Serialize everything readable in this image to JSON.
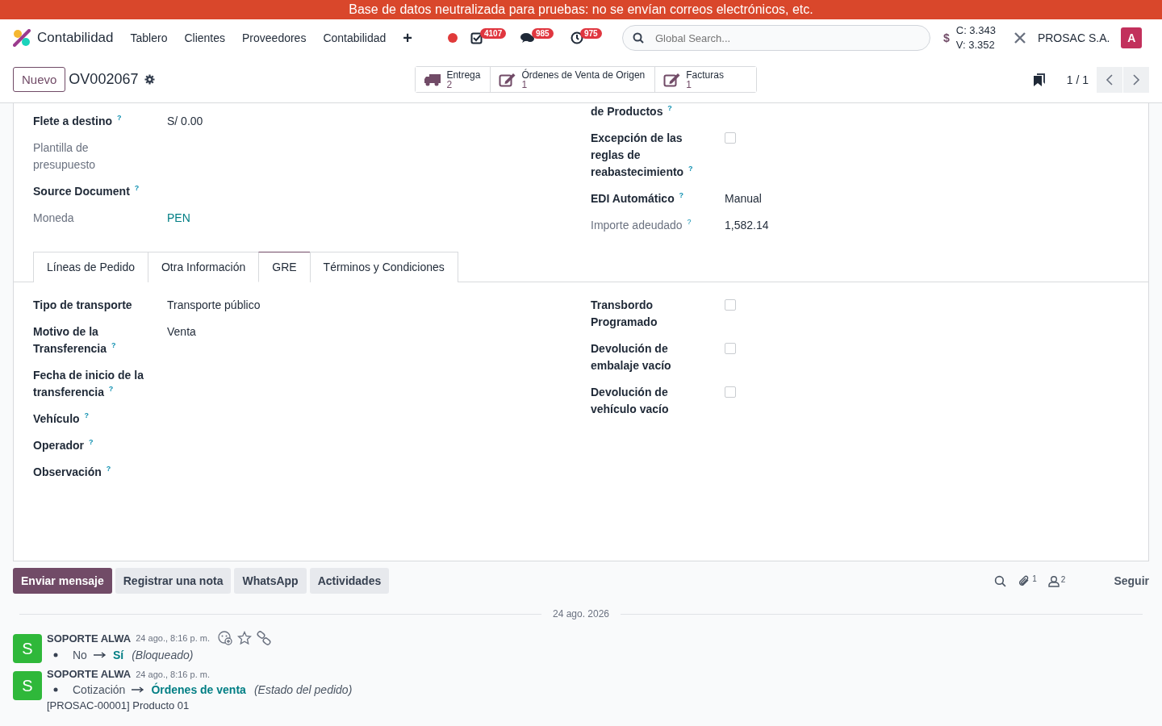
{
  "banner": "Base de datos neutralizada para pruebas: no se envían correos electrónicos, etc.",
  "navbar": {
    "app": "Contabilidad",
    "menu": [
      "Tablero",
      "Clientes",
      "Proveedores",
      "Contabilidad"
    ],
    "plus": "+",
    "systray": [
      {
        "kind": "todo",
        "badge": "4107"
      },
      {
        "kind": "chat",
        "badge": "985"
      },
      {
        "kind": "clock",
        "badge": "975"
      }
    ],
    "search": {
      "placeholder": "Global Search..."
    },
    "currency": "$",
    "rates": [
      "C: 3.343",
      "V: 3.352"
    ],
    "company": "PROSAC S.A.",
    "avatar": "A"
  },
  "control": {
    "new_button": "Nuevo",
    "record": "OV002067",
    "smart_buttons": [
      {
        "kind": "truck",
        "label": "Entrega",
        "count": "2"
      },
      {
        "kind": "edit",
        "label": "Órdenes de Venta de Origen",
        "count": "1"
      },
      {
        "kind": "edit",
        "label": "Facturas",
        "count": "1"
      }
    ],
    "pager": "1 / 1"
  },
  "form": {
    "left": [
      {
        "label": "Flete a destino $^{?}$",
        "muted": false,
        "kind": "text",
        "value": "S/ 0.00"
      },
      {
        "label": "Plantilla de presupuesto",
        "muted": true,
        "kind": "empty"
      },
      {
        "label": "Source Document $^{?}$",
        "muted": false,
        "kind": "empty"
      },
      {
        "label": "Moneda",
        "muted": true,
        "kind": "link",
        "value": "PEN"
      }
    ],
    "right": [
      {
        "label": "de Productos $^{?}$",
        "muted": false,
        "kind": "empty"
      },
      {
        "label": "Excepción de las reglas de reabastecimiento $^{?}$",
        "muted": false,
        "kind": "checkbox",
        "checked": false
      },
      {
        "label": "EDI Automático $^{?}$",
        "muted": false,
        "kind": "text",
        "value": "Manual"
      },
      {
        "label": "Importe adeudado $^{?}$",
        "muted": true,
        "kind": "text",
        "value": "1,582.14"
      }
    ],
    "tabs": [
      {
        "label": "Líneas de Pedido",
        "selected": false
      },
      {
        "label": "Otra Información",
        "selected": false
      },
      {
        "label": "GRE",
        "selected": true
      },
      {
        "label": "Términos y Condiciones",
        "selected": false
      }
    ],
    "tab_left": [
      {
        "label": "Tipo de transporte",
        "muted": false,
        "kind": "text",
        "value": "Transporte público"
      },
      {
        "label": "Motivo de la Transferencia $^{?}$",
        "muted": false,
        "kind": "text",
        "value": "Venta"
      },
      {
        "label": "Fecha de inicio de la transferencia $^{?}$",
        "muted": false,
        "kind": "empty"
      },
      {
        "label": "Vehículo $^{?}$",
        "muted": false,
        "kind": "empty"
      },
      {
        "label": "Operador $^{?}$",
        "muted": false,
        "kind": "empty"
      },
      {
        "label": "Observación $^{?}$",
        "muted": false,
        "kind": "empty"
      }
    ],
    "tab_right": [
      {
        "label": "Transbordo Programado",
        "muted": false,
        "kind": "checkbox",
        "checked": false
      },
      {
        "label": "Devolución de embalaje vacío",
        "muted": false,
        "kind": "checkbox",
        "checked": false
      },
      {
        "label": "Devolución de vehículo vacío",
        "muted": false,
        "kind": "checkbox",
        "checked": false
      }
    ]
  },
  "chatter": {
    "buttons": [
      {
        "label": "Enviar mensaje",
        "selected": true
      },
      {
        "label": "Registrar una nota",
        "selected": false
      },
      {
        "label": "WhatsApp",
        "selected": false
      },
      {
        "label": "Actividades",
        "selected": false
      }
    ],
    "attachments": "1",
    "followers": "2",
    "follow": "Seguir",
    "date": "24 ago. 2026",
    "messages": [
      {
        "avatar": "S",
        "author": "SOPORTE ALWA",
        "time": "24 ago., 8:16 p. m.",
        "actions": true,
        "changes": [
          {
            "old": "No",
            "new": "Sí",
            "field": "(Bloqueado)"
          }
        ]
      },
      {
        "avatar": "S",
        "author": "SOPORTE ALWA",
        "time": "24 ago., 8:16 p. m.",
        "actions": false,
        "changes": [
          {
            "old": "Cotización",
            "new": "Órdenes de venta",
            "field": "(Estado del pedido)"
          }
        ],
        "line": "[PROSAC-00001] Producto 01"
      }
    ]
  }
}
